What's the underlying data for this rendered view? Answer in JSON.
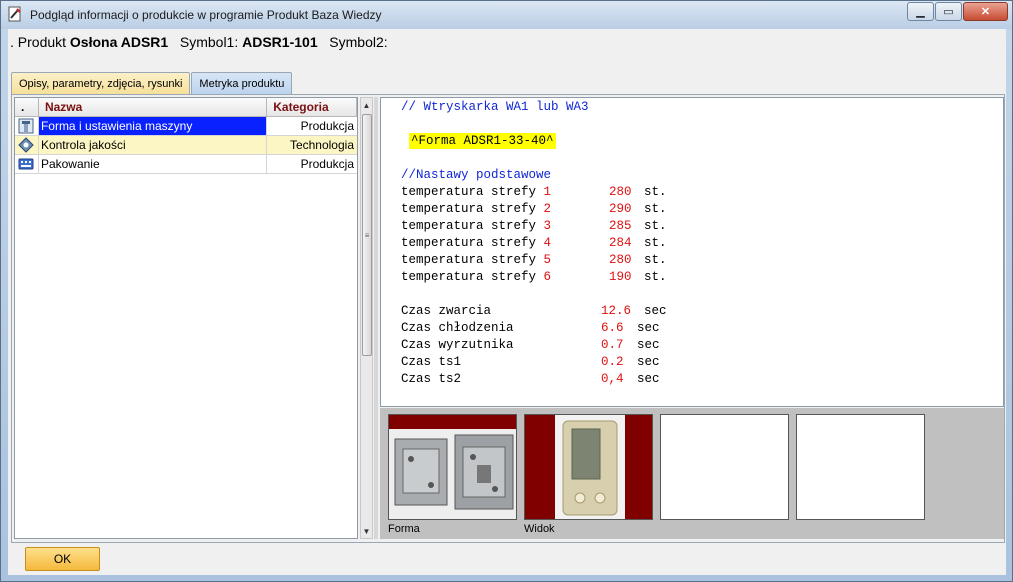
{
  "window": {
    "title": "Podgląd informacji o produkcie w programie Produkt Baza Wiedzy",
    "buttons": {
      "minimize": "▁",
      "maximize": "▭",
      "close": "✕"
    }
  },
  "header": {
    "product_label": ". Produkt",
    "product_value": "Osłona ADSR1",
    "symbol1_label": "Symbol1:",
    "symbol1_value": "ADSR1-101",
    "symbol2_label": "Symbol2:"
  },
  "tabs": [
    {
      "label": "Opisy, parametry, zdjęcia, rysunki",
      "active": true
    },
    {
      "label": "Metryka produktu",
      "active": false
    }
  ],
  "grid": {
    "columns": [
      ".",
      "Nazwa",
      "Kategoria"
    ],
    "rows": [
      {
        "icon": "gear-icon",
        "name": "Forma i ustawienia maszyny",
        "category": "Produkcja",
        "selected": true
      },
      {
        "icon": "quality-diamond-icon",
        "name": "Kontrola jakości",
        "category": "Technologia",
        "selected": false
      },
      {
        "icon": "keyboard-icon",
        "name": "Pakowanie",
        "category": "Produkcja",
        "selected": false
      }
    ]
  },
  "notes": {
    "comment1": "// Wtryskarka WA1 lub WA3",
    "form_tag": "^Forma ADSR1-33-40^",
    "comment2": "//Nastawy podstawowe",
    "zones": [
      {
        "label": "temperatura strefy ",
        "num": "1",
        "value": "280",
        "unit": "st."
      },
      {
        "label": "temperatura strefy ",
        "num": "2",
        "value": "290",
        "unit": "st."
      },
      {
        "label": "temperatura strefy ",
        "num": "3",
        "value": "285",
        "unit": "st."
      },
      {
        "label": "temperatura strefy ",
        "num": "4",
        "value": "284",
        "unit": "st."
      },
      {
        "label": "temperatura strefy ",
        "num": "5",
        "value": "280",
        "unit": "st."
      },
      {
        "label": "temperatura strefy ",
        "num": "6",
        "value": "190",
        "unit": "st."
      }
    ],
    "times": [
      {
        "label": "Czas zwarcia",
        "value": "12.6",
        "unit": "sec"
      },
      {
        "label": "Czas chłodzenia",
        "value": "6.6",
        "unit": "sec"
      },
      {
        "label": "Czas wyrzutnika",
        "value": "0.7",
        "unit": "sec"
      },
      {
        "label": "Czas ts1",
        "value": "0.2",
        "unit": "sec"
      },
      {
        "label": "Czas ts2",
        "value": "0,4",
        "unit": "sec"
      }
    ]
  },
  "images": [
    {
      "caption": "Forma"
    },
    {
      "caption": "Widok"
    },
    {
      "caption": ""
    },
    {
      "caption": ""
    }
  ],
  "ok_button": "OK",
  "colors": {
    "selection": "#0a21ff",
    "highlight": "#ffff00",
    "accent_red": "#e01010",
    "comment_blue": "#1127d6"
  }
}
